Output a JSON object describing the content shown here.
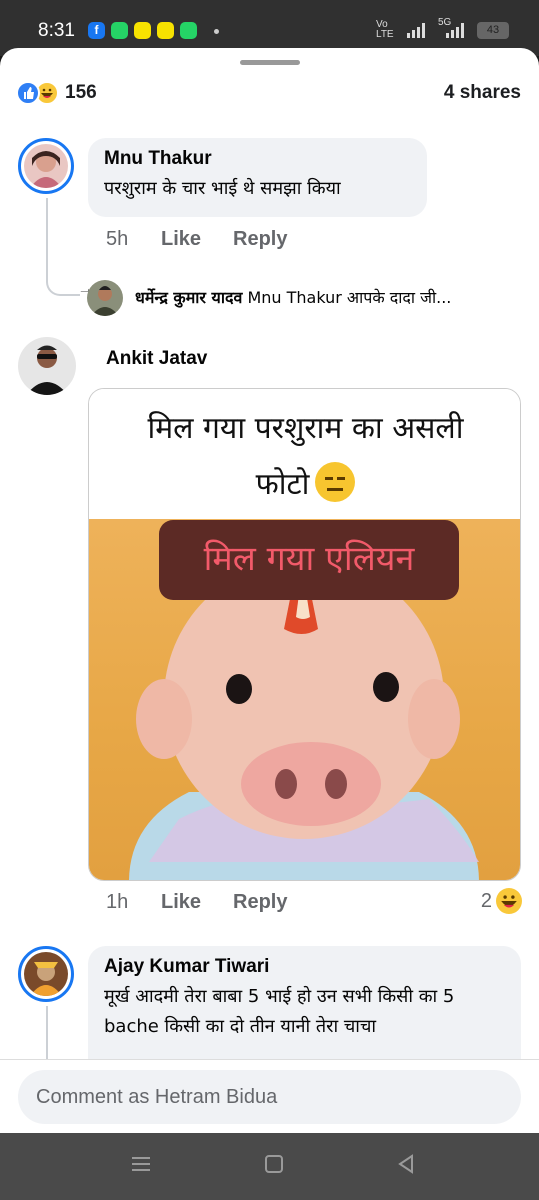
{
  "status_bar": {
    "time": "8:31",
    "apps": [
      "facebook-icon",
      "whatsapp-icon",
      "snapchat-icon",
      "snapchat-icon",
      "whatsapp-icon"
    ],
    "network_label_1": "Vo",
    "network_label_2": "LTE",
    "network_5g": "5G",
    "battery": "43"
  },
  "post_stats": {
    "reaction_count": "156",
    "shares": "4 shares",
    "reaction_icons": [
      "like-icon",
      "haha-icon"
    ]
  },
  "comments": [
    {
      "author": "Mnu Thakur",
      "text": "परशुराम के चार भाई थे समझा किया",
      "time": "5h",
      "like_label": "Like",
      "reply_label": "Reply"
    },
    {
      "author": "Ankit Jatav",
      "image_caption_line1": "मिल गया परशुराम का असली",
      "image_caption_line2": "फोटो",
      "image_banner": "मिल गया एलियन",
      "time": "1h",
      "like_label": "Like",
      "reply_label": "Reply",
      "reaction_count": "2"
    },
    {
      "author": "Ajay Kumar Tiwari",
      "text": "मूर्ख आदमी तेरा बाबा 5 भाई हो उन सभी किसी का 5 bache किसी का दो तीन यानी तेरा चाचा"
    }
  ],
  "reply_preview": {
    "author": "धर्मेन्द्र कुमार यादव",
    "text": "Mnu Thakur आपके दादा जी..."
  },
  "composer": {
    "placeholder": "Comment as Hetram Bidua"
  },
  "colors": {
    "accent": "#1877f2",
    "bubble": "#f0f2f5",
    "meme_bg": "#e7a746",
    "banner": "#5c2a25",
    "banner_text": "#f25a6a"
  }
}
